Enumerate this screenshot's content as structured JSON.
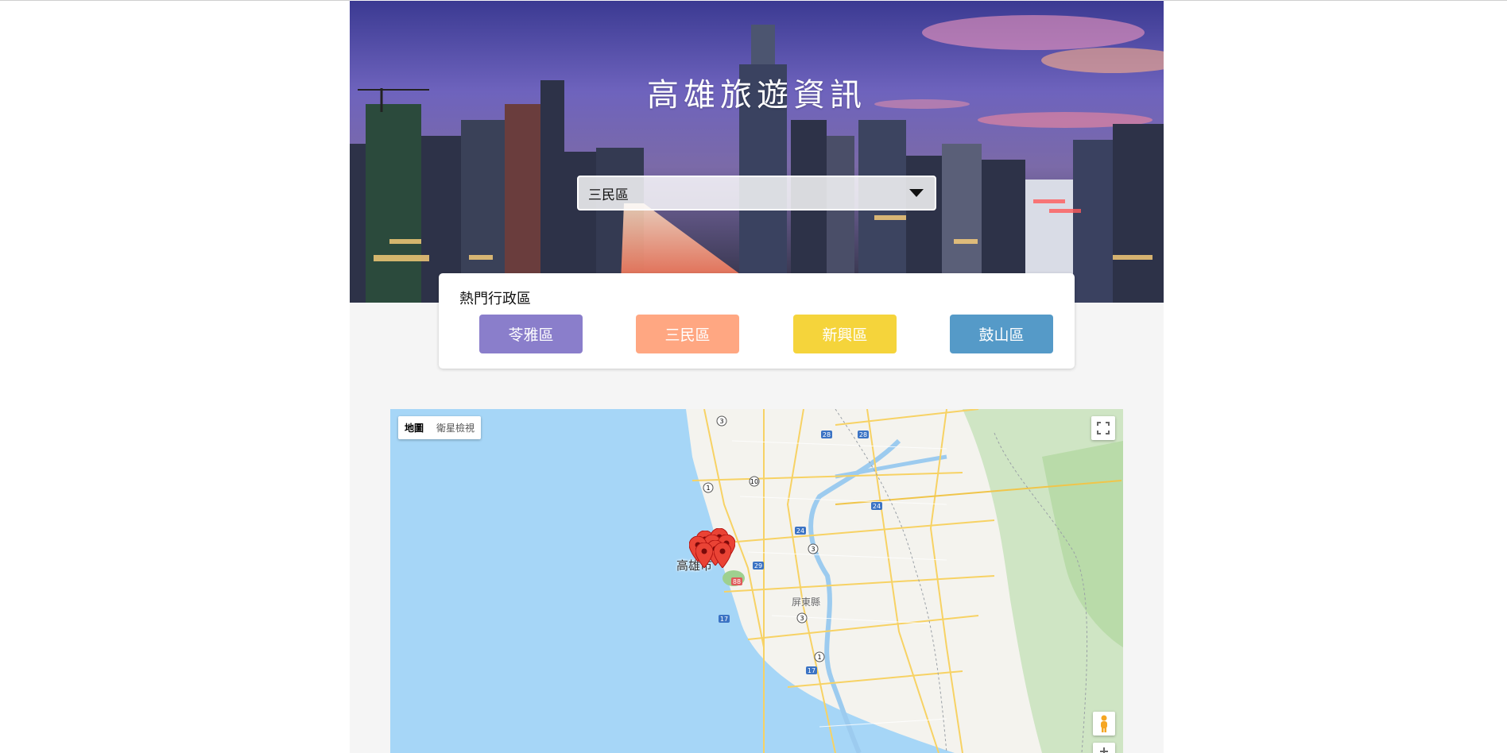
{
  "header": {
    "title": "高雄旅遊資訊",
    "select": {
      "value": "三民區"
    }
  },
  "popular": {
    "title": "熱門行政區",
    "chips": [
      {
        "label": "苓雅區",
        "color": "#8a7ecb"
      },
      {
        "label": "三民區",
        "color": "#ffa782"
      },
      {
        "label": "新興區",
        "color": "#f5d43b"
      },
      {
        "label": "鼓山區",
        "color": "#559ac8"
      }
    ]
  },
  "map": {
    "type_options": [
      "地圖",
      "衛星檢視"
    ],
    "selected_type": "地圖",
    "labels": {
      "city": "高雄市",
      "county": "屏東縣"
    },
    "colors": {
      "sea": "#a6d6f7",
      "land": "#f4f3ee",
      "road": "#f7d264",
      "park": "#c7e3b8",
      "marker": "#ea4335"
    }
  }
}
